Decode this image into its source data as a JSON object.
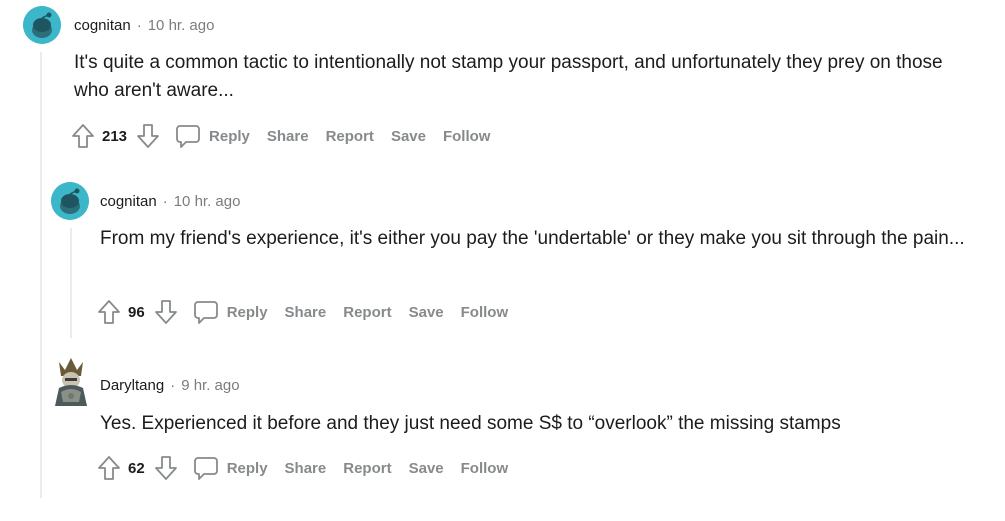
{
  "comments": [
    {
      "author": "cognitan",
      "separator": "·",
      "time": "10 hr. ago",
      "body": "It's quite a common tactic to intentionally not stamp your passport, and unfortunately they prey on those who aren't aware...",
      "score": "213",
      "avatar": "snoo-avatar"
    },
    {
      "author": "cognitan",
      "separator": "·",
      "time": "10 hr. ago",
      "body": "From my friend's experience, it's either you pay the 'undertable' or they make you sit through the pain...",
      "score": "96",
      "avatar": "snoo-avatar"
    },
    {
      "author": "Daryltang",
      "separator": "·",
      "time": "9 hr. ago",
      "body": "Yes. Experienced it before and they just need some S$ to “overlook” the missing stamps",
      "score": "62",
      "avatar": "custom-avatar"
    }
  ],
  "actions": {
    "reply": "Reply",
    "share": "Share",
    "report": "Report",
    "save": "Save",
    "follow": "Follow"
  },
  "colors": {
    "snoo": "#3cb6c9",
    "meta_gray": "#7c7c7c",
    "action_gray": "#878a8c",
    "thread_line": "#e9ebed"
  }
}
